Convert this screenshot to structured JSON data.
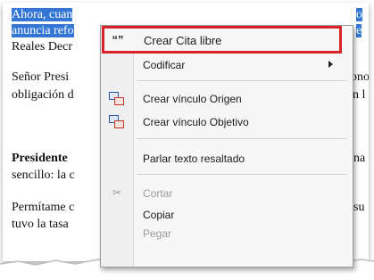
{
  "document": {
    "line1": "Ahora, cuan",
    "line1_tail": "o",
    "line2": "anuncia refo",
    "line2_tail": "e",
    "line3": "Reales Decr",
    "line4": "Señor Presi",
    "line4_tail": "ono",
    "line5": "obligación d",
    "line5_tail": "n l",
    "line6": "Presidente",
    "line6_tail": "na",
    "line7": "sencillo: la c",
    "line8": "Permítame c",
    "line8_tail": "su",
    "line9": "tuvo la tasa"
  },
  "context_menu": {
    "items": [
      {
        "label": "Crear Cita libre",
        "icon": "quote-icon",
        "icon_glyph": "“”"
      },
      {
        "label": "Codificar",
        "submenu": true
      },
      {
        "label": "Crear vínculo Origen",
        "icon": "link-source-icon"
      },
      {
        "label": "Crear vínculo Objetivo",
        "icon": "link-target-icon"
      },
      {
        "label": "Parlar texto resaltado"
      },
      {
        "label": "Cortar",
        "icon": "scissors-icon",
        "icon_glyph": "✂",
        "disabled": true
      },
      {
        "label": "Copiar"
      },
      {
        "label": "Pegar",
        "disabled": true
      }
    ]
  },
  "colors": {
    "selection": "#3376d6",
    "highlight_border": "#d8232a"
  }
}
